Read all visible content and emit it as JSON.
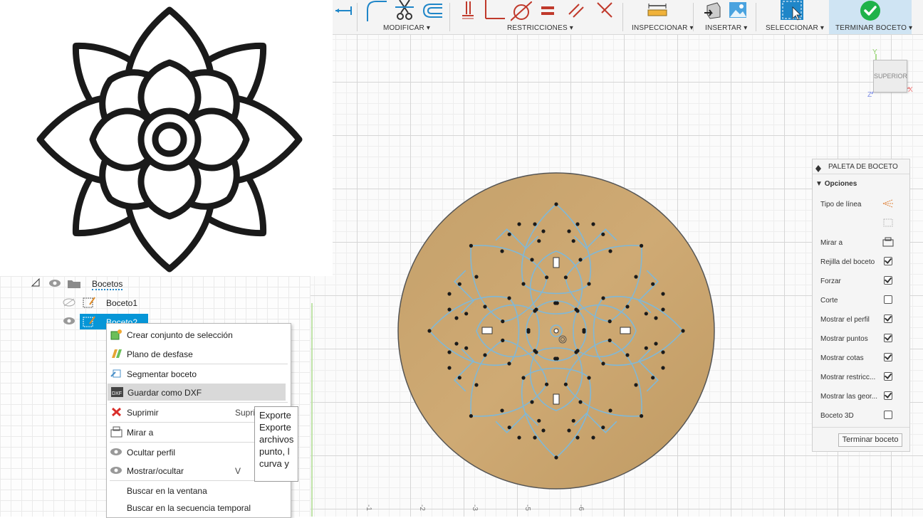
{
  "toolbar": {
    "modify_label": "MODIFICAR ▾",
    "constraints_label": "RESTRICCIONES ▾",
    "inspect_label": "INSPECCIONAR ▾",
    "insert_label": "INSERTAR ▾",
    "select_label": "SELECCIONAR ▾",
    "finish_label": "TERMINAR BOCETO ▾"
  },
  "viewcube": {
    "face": "SUPERIOR",
    "axis_x": "X",
    "axis_y": "Y",
    "axis_z": "Z"
  },
  "browser": {
    "folder_label": "Bocetos",
    "items": [
      {
        "label": "Boceto1",
        "visible": false
      },
      {
        "label": "Boceto2",
        "visible": true,
        "selected": true
      }
    ]
  },
  "context_menu": {
    "items": [
      {
        "label": "Crear conjunto de selección",
        "icon": "selection-set-icon"
      },
      {
        "label": "Plano de desfase",
        "icon": "offset-plane-icon"
      },
      {
        "label": "Segmentar boceto",
        "icon": "break-sketch-icon"
      },
      {
        "label": "Guardar como DXF",
        "icon": "dxf-icon",
        "highlighted": true
      },
      {
        "label": "Suprimir",
        "icon": "delete-x-icon",
        "shortcut": "Supri"
      },
      {
        "label": "Mirar a",
        "icon": "look-at-icon"
      },
      {
        "label": "Ocultar perfil",
        "icon": "eye-icon"
      },
      {
        "label": "Mostrar/ocultar",
        "icon": "eye-icon",
        "shortcut": "V"
      },
      {
        "label": "Buscar en la ventana",
        "icon": ""
      },
      {
        "label": "Buscar en la secuencia temporal",
        "icon": ""
      }
    ]
  },
  "tooltip": {
    "lines": [
      "Exporte",
      "Exporte",
      "archivos",
      "punto, l",
      "curva y"
    ]
  },
  "palette": {
    "title": "PALETA DE BOCETO",
    "section": "Opciones",
    "rows": [
      {
        "label": "Tipo de línea",
        "type": "icon",
        "icon": "linetype-icon"
      },
      {
        "label": "",
        "type": "icon",
        "icon": "construction-icon"
      },
      {
        "label": "Mirar a",
        "type": "icon",
        "icon": "look-at-icon"
      },
      {
        "label": "Rejilla del boceto",
        "type": "check",
        "checked": true
      },
      {
        "label": "Forzar",
        "type": "check",
        "checked": true
      },
      {
        "label": "Corte",
        "type": "check",
        "checked": false
      },
      {
        "label": "Mostrar el perfil",
        "type": "check",
        "checked": true
      },
      {
        "label": "Mostrar puntos",
        "type": "check",
        "checked": true
      },
      {
        "label": "Mostrar cotas",
        "type": "check",
        "checked": true
      },
      {
        "label": "Mostrar restricc...",
        "type": "check",
        "checked": true
      },
      {
        "label": "Mostrar las geor...",
        "type": "check",
        "checked": true
      },
      {
        "label": "Boceto 3D",
        "type": "check",
        "checked": false
      }
    ],
    "finish_button": "Terminar boceto"
  },
  "ruler": {
    "ticks": [
      "-1",
      "-2",
      "-3",
      "-5",
      "-6"
    ]
  },
  "colors": {
    "accent": "#0696d7",
    "sketch_line": "#7fb8d8",
    "disc": "#c9a46c",
    "selected_row": "#0696d7"
  }
}
